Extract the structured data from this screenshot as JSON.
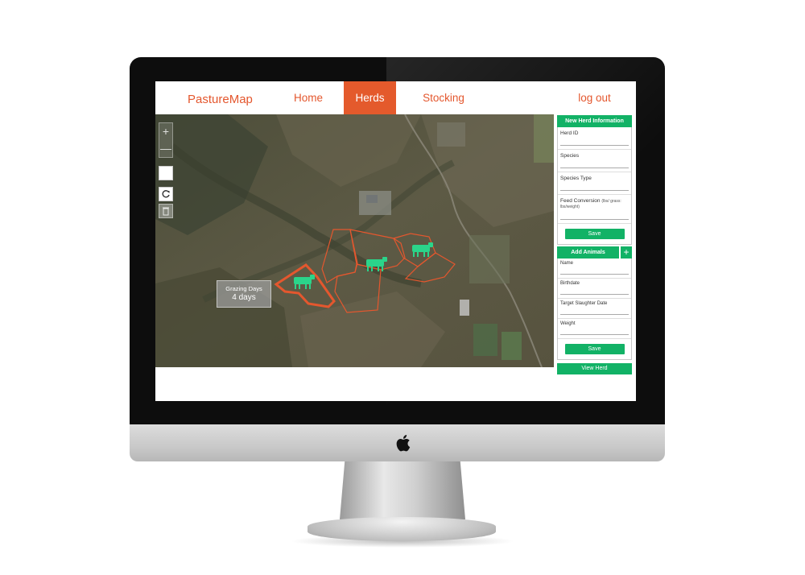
{
  "app": {
    "brand": "PastureMap",
    "nav": {
      "home": "Home",
      "herds": "Herds",
      "stocking": "Stocking",
      "logout": "log out"
    }
  },
  "map": {
    "controls": {
      "zoom_in": "+",
      "zoom_out": "—"
    },
    "grazing_badge": {
      "label": "Grazing Days",
      "value": "4 days"
    },
    "paddock_color": "#e4572e",
    "herd_icon_color": "#2bd48a"
  },
  "panel": {
    "herd_info": {
      "title": "New Herd Information",
      "fields": {
        "herd_id": "Herd ID",
        "species": "Species",
        "species_type": "Species Type",
        "feed_conversion": "Feed Conversion",
        "feed_conversion_hint": "(lbs/ grass: lbs/weight)"
      },
      "save": "Save"
    },
    "animals": {
      "title": "Add Animals",
      "add": "+",
      "fields": {
        "name": "Name",
        "birthdate": "Birthdate",
        "target_slaughter_date": "Target Slaughter Date",
        "weight": "Weight"
      },
      "save": "Save"
    },
    "view_herd": "View Herd",
    "accent_color": "#12b266"
  }
}
